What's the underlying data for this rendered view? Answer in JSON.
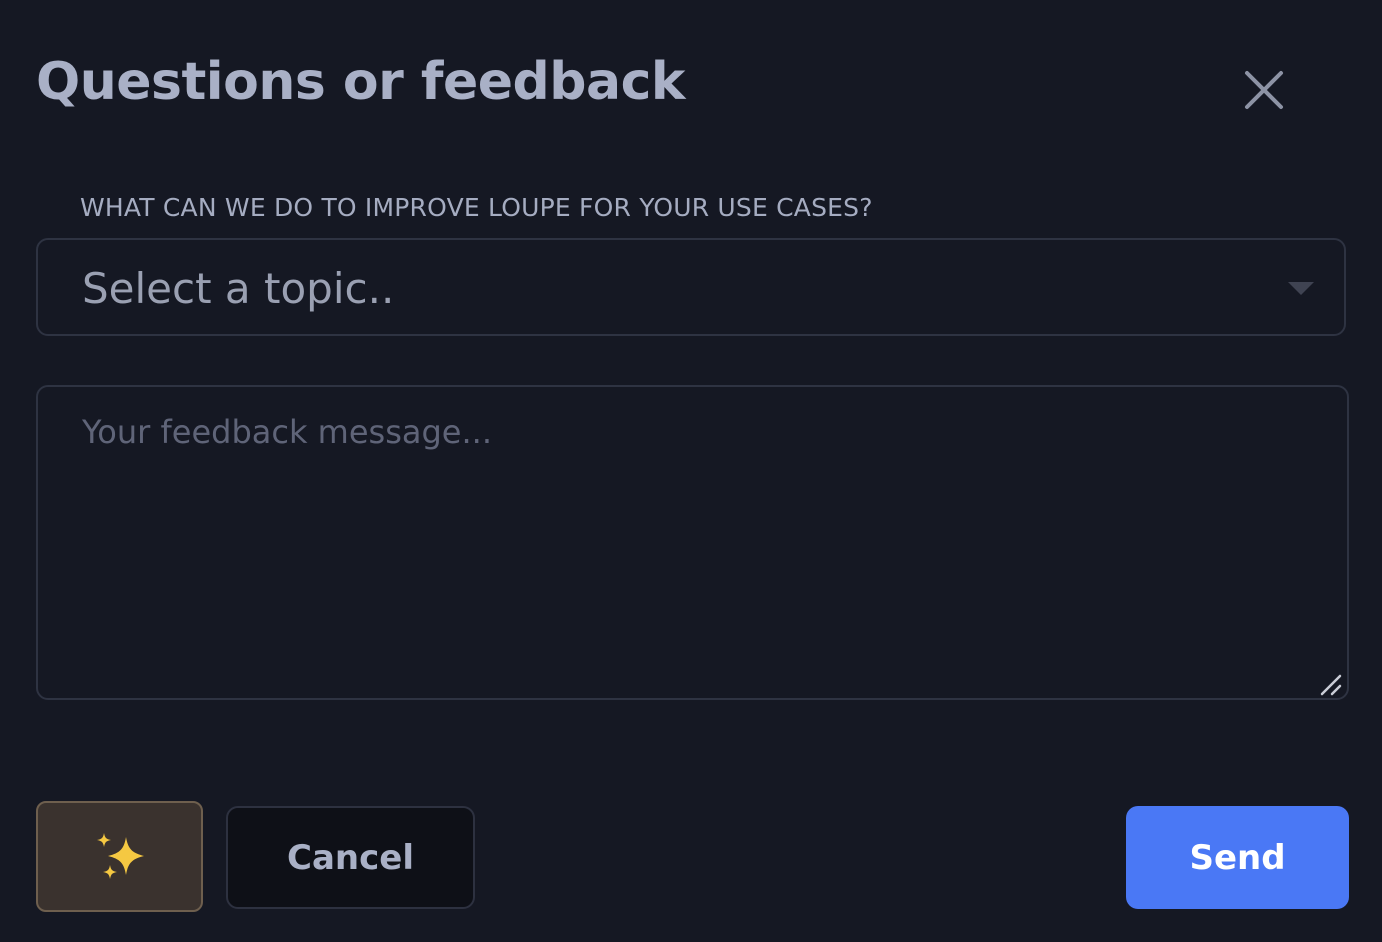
{
  "dialog": {
    "title": "Questions or feedback",
    "close_icon": "close-icon"
  },
  "form": {
    "topic_label": "WHAT CAN WE DO TO IMPROVE LOUPE FOR YOUR USE CASES?",
    "topic_selected": "Select a topic..",
    "message_placeholder": "Your feedback message..."
  },
  "actions": {
    "sparkle_icon": "sparkles-icon",
    "cancel_label": "Cancel",
    "send_label": "Send"
  },
  "colors": {
    "background": "#151823",
    "primary": "#4a78f5",
    "sparkle_bg": "#3a322e",
    "sparkle": "#f5c842"
  }
}
